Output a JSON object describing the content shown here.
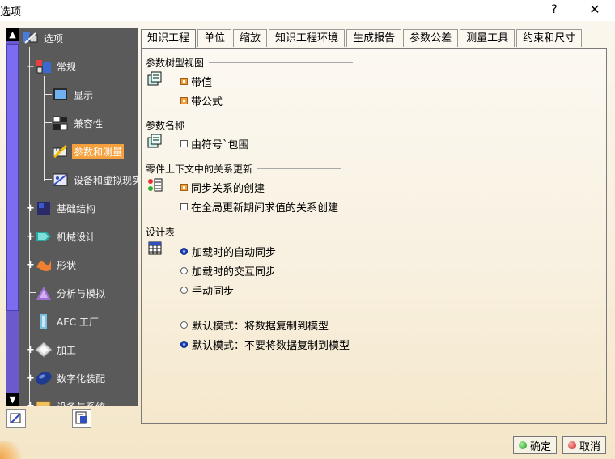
{
  "window": {
    "title": "选项",
    "help_label": "?",
    "close_label": "✕"
  },
  "tree": {
    "items": [
      {
        "label": "选项",
        "icon": "options-root-icon"
      },
      {
        "label": "常规",
        "icon": "general-icon"
      },
      {
        "label": "显示",
        "icon": "display-icon"
      },
      {
        "label": "兼容性",
        "icon": "compatibility-icon"
      },
      {
        "label": "参数和测量",
        "icon": "parameters-measure-icon",
        "selected": true
      },
      {
        "label": "设备和虚拟现实",
        "icon": "devices-vr-icon"
      },
      {
        "label": "基础结构",
        "icon": "infrastructure-icon"
      },
      {
        "label": "机械设计",
        "icon": "mechanical-design-icon"
      },
      {
        "label": "形状",
        "icon": "shape-icon"
      },
      {
        "label": "分析与模拟",
        "icon": "analysis-simulation-icon"
      },
      {
        "label": "AEC 工厂",
        "icon": "aec-plant-icon"
      },
      {
        "label": "加工",
        "icon": "machining-icon"
      },
      {
        "label": "数字化装配",
        "icon": "digital-mockup-icon"
      },
      {
        "label": "设备与系统",
        "icon": "equipment-systems-icon"
      }
    ],
    "scroll_up": "▲",
    "scroll_down": "▼"
  },
  "tabs": [
    {
      "label": "知识工程",
      "active": true
    },
    {
      "label": "单位"
    },
    {
      "label": "缩放"
    },
    {
      "label": "知识工程环境"
    },
    {
      "label": "生成报告"
    },
    {
      "label": "参数公差"
    },
    {
      "label": "测量工具"
    },
    {
      "label": "约束和尺寸"
    }
  ],
  "sections": {
    "tree_view": {
      "title": "参数树型视图",
      "with_value": {
        "label": "带值",
        "checked": true
      },
      "with_formula": {
        "label": "带公式",
        "checked": true
      }
    },
    "param_name": {
      "title": "参数名称",
      "surrounded_by_symbol": {
        "label": "由符号`包围",
        "checked": false
      }
    },
    "relations_update": {
      "title": "零件上下文中的关系更新",
      "sync_relations": {
        "label": "同步关系的创建",
        "checked": true
      },
      "global_update": {
        "label": "在全局更新期间求值的关系创建",
        "checked": false
      }
    },
    "design_table": {
      "title": "设计表",
      "auto_sync_on_load": {
        "label": "加载时的自动同步",
        "checked": true
      },
      "interactive_sync_on_load": {
        "label": "加载时的交互同步",
        "checked": false
      },
      "manual_sync": {
        "label": "手动同步",
        "checked": false
      },
      "default_copy": {
        "label": "默认模式：将数据复制到模型",
        "checked": false
      },
      "default_nocopy": {
        "label": "默认模式：不要将数据复制到模型",
        "checked": true
      }
    }
  },
  "buttons": {
    "ok": "确定",
    "cancel": "取消"
  },
  "colors": {
    "selection": "#f5a03c",
    "tree_bg": "#5a5a5a",
    "scrollbar": "#6a5acd"
  }
}
